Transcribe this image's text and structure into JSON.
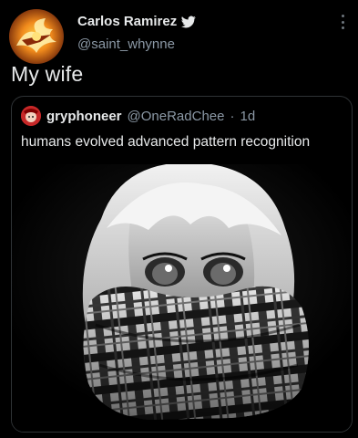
{
  "author": {
    "display_name": "Carlos Ramirez",
    "handle": "@saint_whynne",
    "avatar_icon": "flaming-emblem-avatar",
    "verified_icon": "twitter-bird-icon"
  },
  "tweet": {
    "text": "My wife"
  },
  "quoted_tweet": {
    "display_name": "gryphoneer",
    "handle": "@OneRadChee",
    "separator": "·",
    "time": "1d",
    "text": "humans evolved advanced pattern recognition",
    "media_icon": "scarf-pattern-image"
  },
  "colors": {
    "background": "#000000",
    "text_primary": "#e7e9ea",
    "text_secondary": "#8b98a5",
    "border": "#2f3336"
  }
}
